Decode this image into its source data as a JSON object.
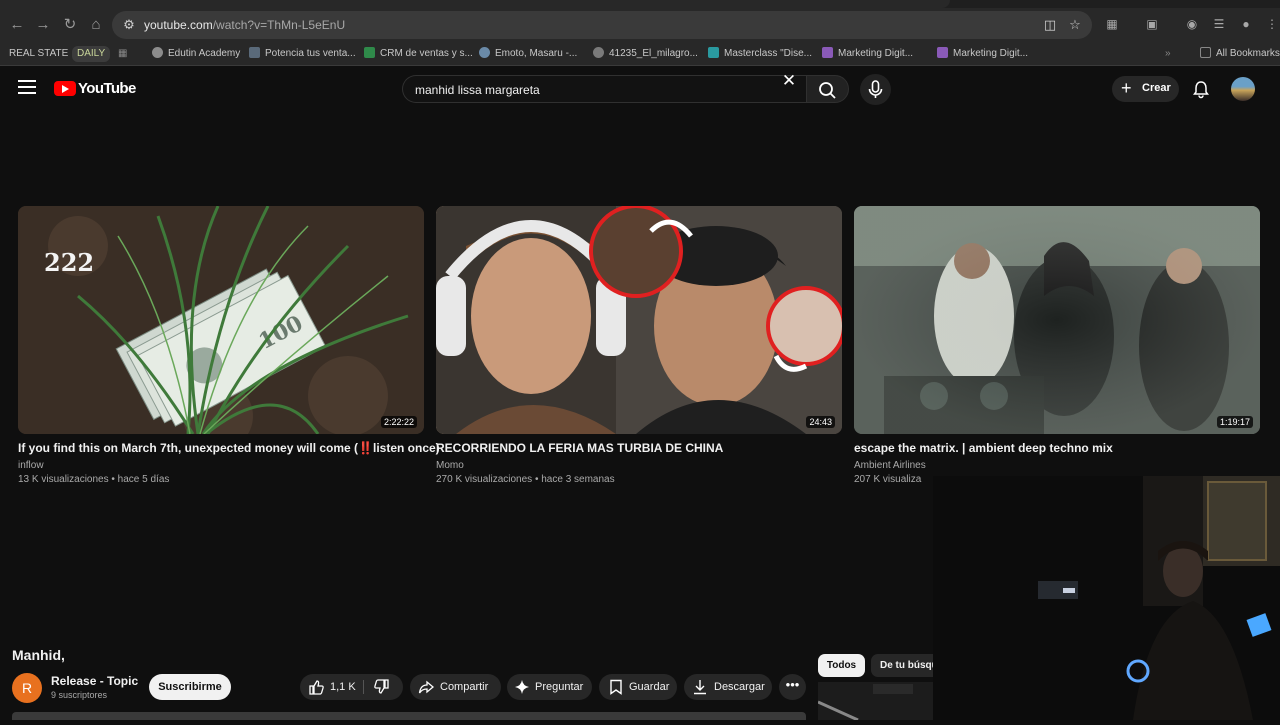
{
  "browser": {
    "url_host": "youtube.com",
    "url_path": "/watch?v=ThMn-L5eEnU"
  },
  "bookmarks": [
    {
      "label": "REAL STATE",
      "favicon": "none"
    },
    {
      "label": "DAILY",
      "favicon": "none"
    },
    {
      "label": "Edutin Academy",
      "favicon": "edutin-icon"
    },
    {
      "label": "Potencia tus venta...",
      "favicon": "page-icon"
    },
    {
      "label": "CRM de ventas y s...",
      "favicon": "crm-icon"
    },
    {
      "label": "Emoto, Masaru -...",
      "favicon": "globe-icon"
    },
    {
      "label": "41235_El_milagro...",
      "favicon": "gear-icon"
    },
    {
      "label": "Masterclass \"Dise...",
      "favicon": "x-icon"
    },
    {
      "label": "Marketing Digit...",
      "favicon": "q-icon"
    },
    {
      "label": "Marketing Digit...",
      "favicon": "q-icon"
    }
  ],
  "all_bookmarks_label": "All Bookmarks",
  "youtube": {
    "logo_text": "YouTube",
    "search_value": "manhid lissa margareta",
    "create_label": "Crear"
  },
  "videos": [
    {
      "title": "If you find this on March 7th, unexpected money will come (‼️listen once)",
      "channel": "inflow",
      "views": "13 K visualizaciones",
      "age": "hace 5 días",
      "duration": "2:22:22",
      "thumb_text": "222"
    },
    {
      "title": "RECORRIENDO LA FERIA MAS TURBIA DE CHINA",
      "channel": "Momo",
      "views": "270 K visualizaciones",
      "age": "hace 3 semanas",
      "duration": "24:43"
    },
    {
      "title": "escape the matrix. | ambient deep techno mix",
      "channel": "Ambient Airlines",
      "views": "207 K visualiza",
      "age": "",
      "duration": "1:19:17"
    }
  ],
  "watch": {
    "title": "Manhid,",
    "channel_initial": "R",
    "channel_name": "Release - Topic",
    "subscribers": "9 suscriptores",
    "subscribe_label": "Suscribirme",
    "like_count": "1,1 K",
    "share_label": "Compartir",
    "ask_label": "Preguntar",
    "save_label": "Guardar",
    "download_label": "Descargar",
    "more_label": "•••"
  },
  "filters": {
    "all_label": "Todos",
    "search_label": "De tu búsqueda"
  }
}
